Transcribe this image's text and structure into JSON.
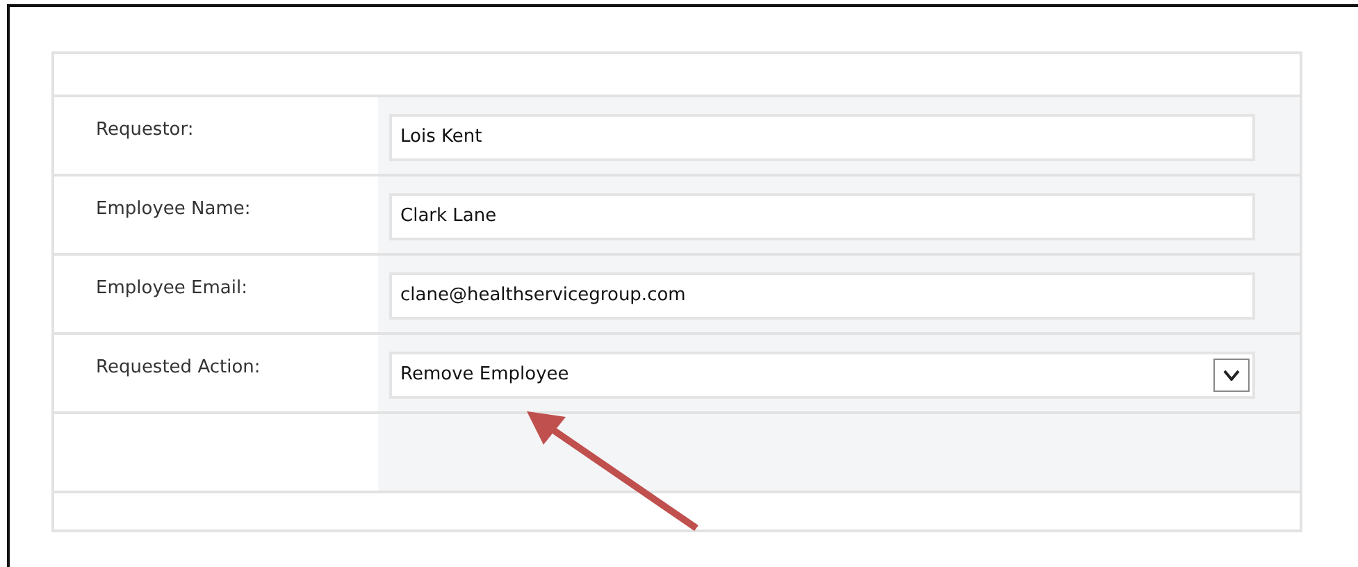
{
  "form": {
    "fields": [
      {
        "label": "Requestor:",
        "kind": "text",
        "value": "Lois Kent"
      },
      {
        "label": "Employee Name:",
        "kind": "text",
        "value": "Clark Lane"
      },
      {
        "label": "Employee Email:",
        "kind": "text",
        "value": "clane@healthservicegroup.com"
      },
      {
        "label": "Requested Action:",
        "kind": "select",
        "value": "Remove Employee"
      }
    ]
  },
  "annotations": [
    {
      "kind": "arrow"
    }
  ]
}
